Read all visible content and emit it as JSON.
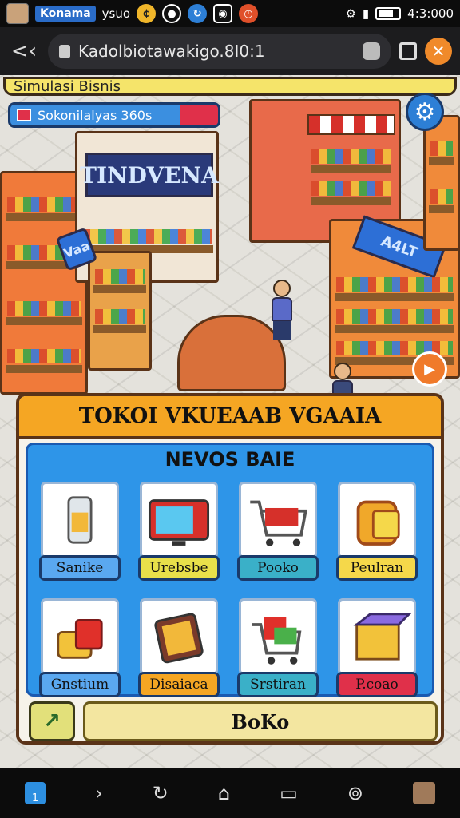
{
  "status_bar": {
    "app_label": "Konama",
    "carrier": "ysuo",
    "time": "4:3:000"
  },
  "browser": {
    "back_glyph": "<‹",
    "url": "Kadolbiotawakigo.8I0:1",
    "menu_glyph": "✕"
  },
  "game": {
    "title": "Simulasi Bisnis",
    "store_name": "Sokonilalyas 360s",
    "gear_glyph": "⚙",
    "side_button_glyph": "▶",
    "signs": {
      "main": "TINDVENA",
      "corner": "Vaa",
      "right": "A4LT"
    },
    "dialog": {
      "title": "TOKOI VKUEAAB VGAAIA",
      "subtitle": "NEVOS BAIE",
      "items": [
        {
          "label": "Sanike",
          "icon": "can-icon",
          "pill_color": "#5aa8f0"
        },
        {
          "label": "Urebsbe",
          "icon": "tv-icon",
          "pill_color": "#e8e04a"
        },
        {
          "label": "Pooko",
          "icon": "shopping-cart-icon",
          "pill_color": "#3ab0c8"
        },
        {
          "label": "Peulran",
          "icon": "bag-icon",
          "pill_color": "#f5d84a"
        },
        {
          "label": "Gnstium",
          "icon": "toast-icon",
          "pill_color": "#5aa8f0"
        },
        {
          "label": "Disaiaca",
          "icon": "tablet-icon",
          "pill_color": "#f5a623"
        },
        {
          "label": "Srstiran",
          "icon": "trolley-icon",
          "pill_color": "#3ab0c8"
        },
        {
          "label": "P.coao",
          "icon": "box-icon",
          "pill_color": "#e0304a"
        }
      ],
      "footer_button": "BoKo",
      "footer_icon": "plus-icon"
    }
  },
  "navbar": {
    "home_label": "1"
  }
}
